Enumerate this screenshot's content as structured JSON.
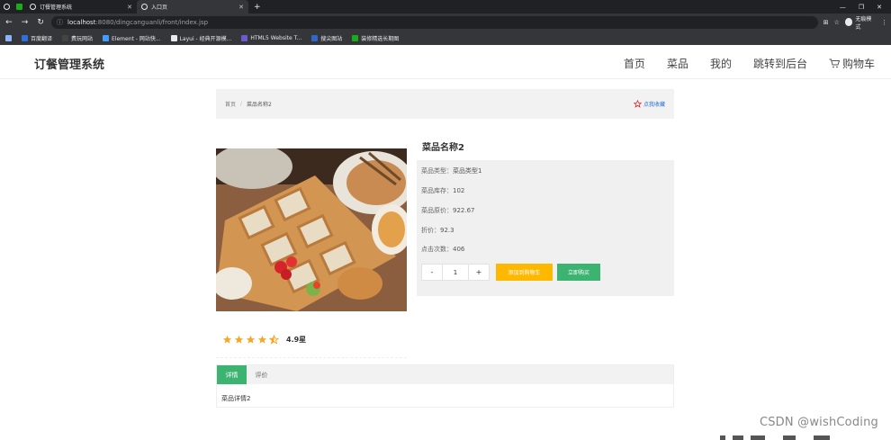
{
  "browser": {
    "tabs": [
      {
        "title": "订餐管理系统",
        "active": false
      },
      {
        "title": "入口页",
        "active": true
      }
    ],
    "url_host": "localhost",
    "url_path": ":8080/dingcanguanli/front/index.jsp",
    "incognito_label": "无痕模式",
    "bookmarks": [
      {
        "label": "百度翻译",
        "color": "#2f6fe0"
      },
      {
        "label": "费玩网站",
        "color": "#444444"
      },
      {
        "label": "Element - 网站快...",
        "color": "#409eff"
      },
      {
        "label": "Layui - 经典开源模...",
        "color": "#e8eaed"
      },
      {
        "label": "HTML5 Website T...",
        "color": "#6a5acd"
      },
      {
        "label": "搜尖图站",
        "color": "#3366cc"
      },
      {
        "label": "装修精选长期图",
        "color": "#1aad19"
      }
    ]
  },
  "site": {
    "logo": "订餐管理系统",
    "nav": [
      "首页",
      "菜品",
      "我的",
      "跳转到后台",
      "购物车"
    ]
  },
  "breadcrumb": {
    "home": "首页",
    "separator": "/",
    "current": "菜品名称2",
    "favorite": "点我收藏"
  },
  "product": {
    "name": "菜品名称2",
    "fields": [
      {
        "label": "菜品类型：",
        "value": "菜品类型1"
      },
      {
        "label": "菜品库存：",
        "value": "102"
      },
      {
        "label": "菜品原价：",
        "value": "922.67"
      },
      {
        "label": "折价：",
        "value": "92.3"
      },
      {
        "label": "点击次数：",
        "value": "406"
      }
    ],
    "quantity": "1",
    "minus": "-",
    "plus": "+",
    "add_to_cart": "添加到购物车",
    "buy_now": "立即购买",
    "rating": 4.9,
    "rating_max": 5,
    "rating_text": "4.9星"
  },
  "tabs": {
    "items": [
      "详情",
      "评价"
    ],
    "active": 0,
    "content": "菜品详情2"
  },
  "watermark": "CSDN @wishCoding",
  "colors": {
    "accent_green": "#3cb371",
    "button_yellow": "#ffb800",
    "star": "#f5a623",
    "link_blue": "#1e6bd6"
  }
}
